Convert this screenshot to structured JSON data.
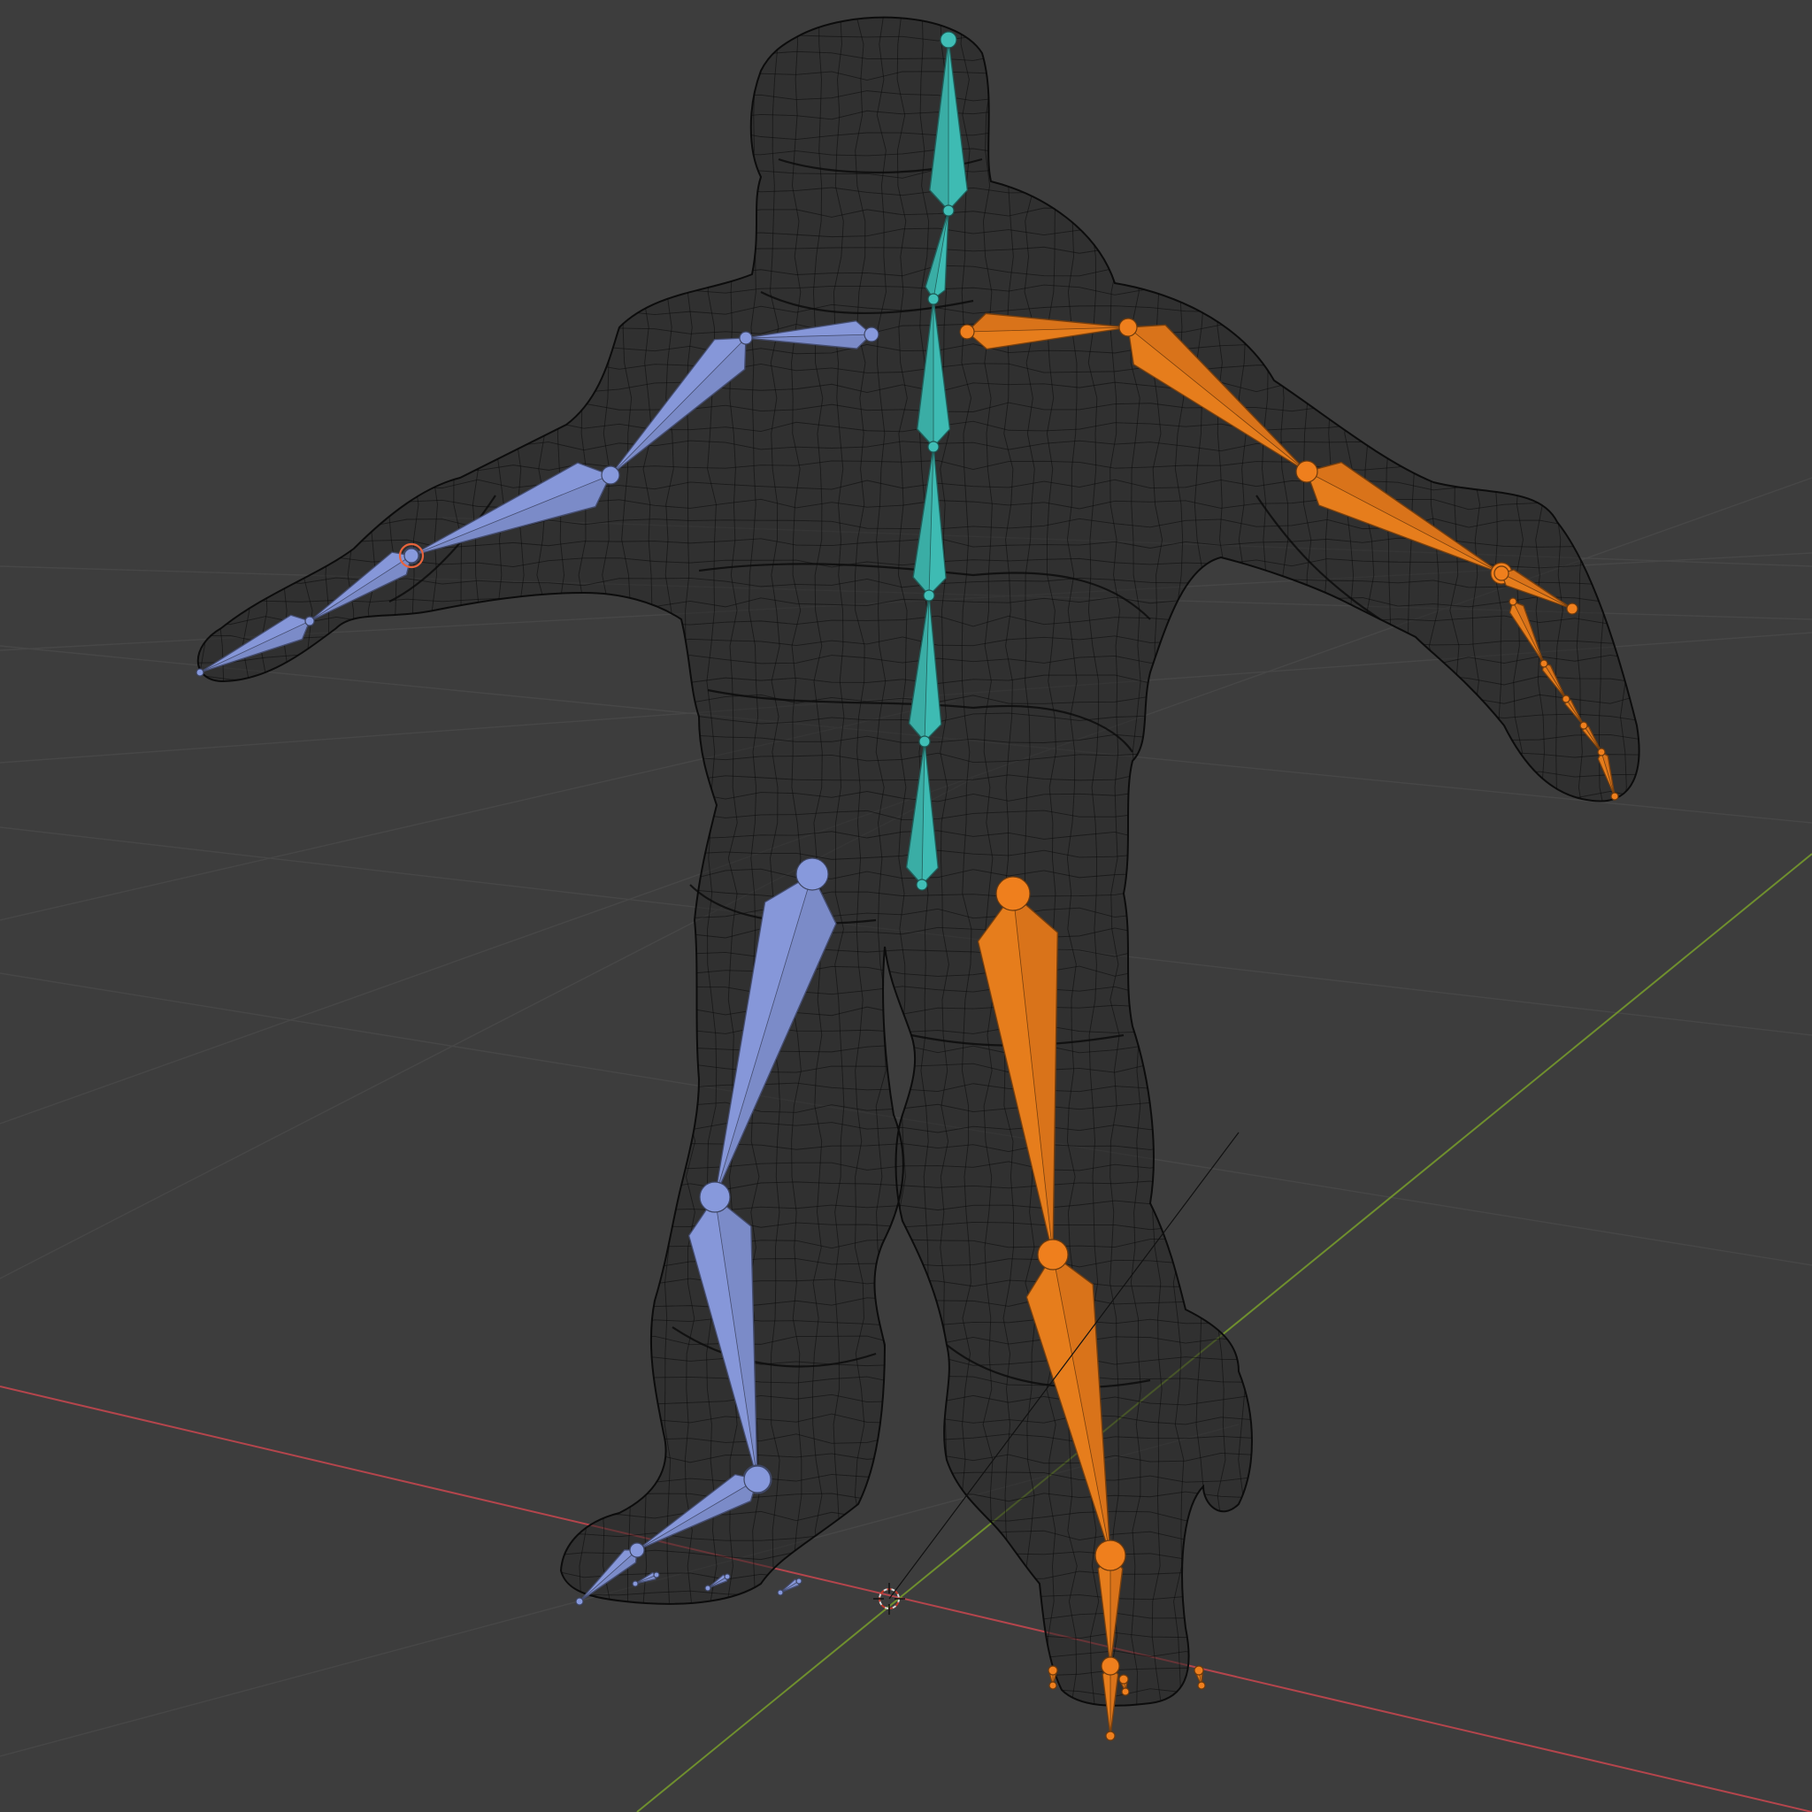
{
  "viewport": {
    "background": "#3d3d3d",
    "mode": "wireframe",
    "grid_color": "#474747",
    "x_axis_color": "#b4454c",
    "y_axis_color": "#6f8f2e",
    "mesh_wire_color": "#0a0a0a"
  },
  "armature": {
    "colors": {
      "center": "#3aada5",
      "left": "#7b8bc8",
      "right": "#d9731a"
    },
    "bone_groups": [
      {
        "name_key": "spine",
        "group": "center",
        "count": 7
      },
      {
        "name_key": "left-arm",
        "group": "left",
        "count": 5
      },
      {
        "name_key": "right-arm",
        "group": "right",
        "count": 8
      },
      {
        "name_key": "left-leg",
        "group": "left",
        "count": 7
      },
      {
        "name_key": "right-leg",
        "group": "right",
        "count": 7
      }
    ]
  },
  "icons": {
    "origin": "cursor-3d-icon"
  }
}
